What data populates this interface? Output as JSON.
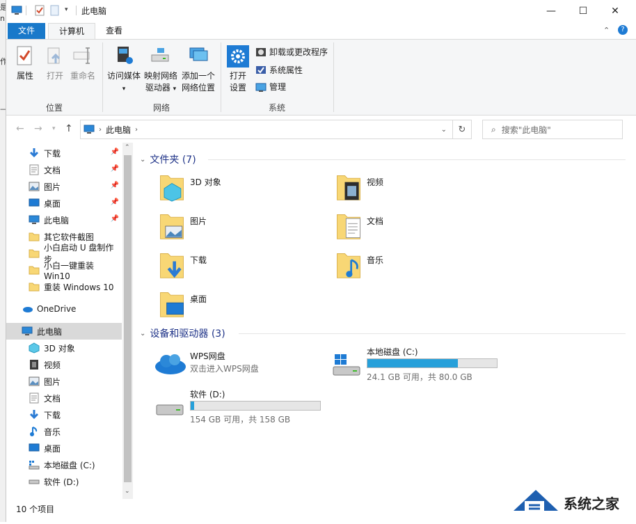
{
  "window": {
    "title": "此电脑"
  },
  "tabs": {
    "file": "文件",
    "computer": "计算机",
    "view": "查看"
  },
  "ribbon": {
    "location": {
      "label": "位置",
      "properties": "属性",
      "open": "打开",
      "rename": "重命名"
    },
    "network": {
      "label": "网络",
      "access_media": "访问媒体",
      "map_drive_1": "映射网络",
      "map_drive_2": "驱动器",
      "add_location_1": "添加一个",
      "add_location_2": "网络位置"
    },
    "system": {
      "label": "系统",
      "open_settings_1": "打开",
      "open_settings_2": "设置",
      "uninstall": "卸载或更改程序",
      "sys_props": "系统属性",
      "manage": "管理"
    }
  },
  "address": {
    "path": "此电脑",
    "search_placeholder": "搜索\"此电脑\""
  },
  "navpane": {
    "quick": [
      {
        "label": "下载",
        "icon": "download-icon",
        "pinned": true
      },
      {
        "label": "文档",
        "icon": "document-icon",
        "pinned": true
      },
      {
        "label": "图片",
        "icon": "picture-icon",
        "pinned": true
      },
      {
        "label": "桌面",
        "icon": "desktop-icon",
        "pinned": true
      },
      {
        "label": "此电脑",
        "icon": "computer-icon",
        "pinned": true
      },
      {
        "label": "其它软件截图",
        "icon": "folder-icon"
      },
      {
        "label": "小白启动 U 盘制作步",
        "icon": "folder-icon"
      },
      {
        "label": "小白一键重装 Win10",
        "icon": "folder-icon"
      },
      {
        "label": "重装 Windows 10",
        "icon": "folder-icon"
      }
    ],
    "onedrive": "OneDrive",
    "thispc": "此电脑",
    "pc_items": [
      {
        "label": "3D 对象",
        "icon": "3d-icon"
      },
      {
        "label": "视频",
        "icon": "video-icon"
      },
      {
        "label": "图片",
        "icon": "picture-icon"
      },
      {
        "label": "文档",
        "icon": "document-icon"
      },
      {
        "label": "下载",
        "icon": "download-icon"
      },
      {
        "label": "音乐",
        "icon": "music-icon"
      },
      {
        "label": "桌面",
        "icon": "desktop-icon"
      },
      {
        "label": "本地磁盘 (C:)",
        "icon": "drive-c-icon"
      },
      {
        "label": "软件 (D:)",
        "icon": "drive-icon"
      }
    ]
  },
  "content": {
    "folders_header": "文件夹 (7)",
    "folders": [
      {
        "name": "3D 对象"
      },
      {
        "name": "视频"
      },
      {
        "name": "图片"
      },
      {
        "name": "文档"
      },
      {
        "name": "下载"
      },
      {
        "name": "音乐"
      },
      {
        "name": "桌面"
      }
    ],
    "devices_header": "设备和驱动器 (3)",
    "wps": {
      "name": "WPS网盘",
      "desc": "双击进入WPS网盘"
    },
    "drive_c": {
      "name": "本地磁盘 (C:)",
      "space": "24.1 GB 可用，共 80.0 GB",
      "used_fraction": 0.7
    },
    "drive_d": {
      "name": "软件 (D:)",
      "space": "154 GB 可用，共 158 GB",
      "used_fraction": 0.025
    }
  },
  "status": {
    "count": "10 个项目"
  },
  "watermark": {
    "text": "系统之家"
  }
}
